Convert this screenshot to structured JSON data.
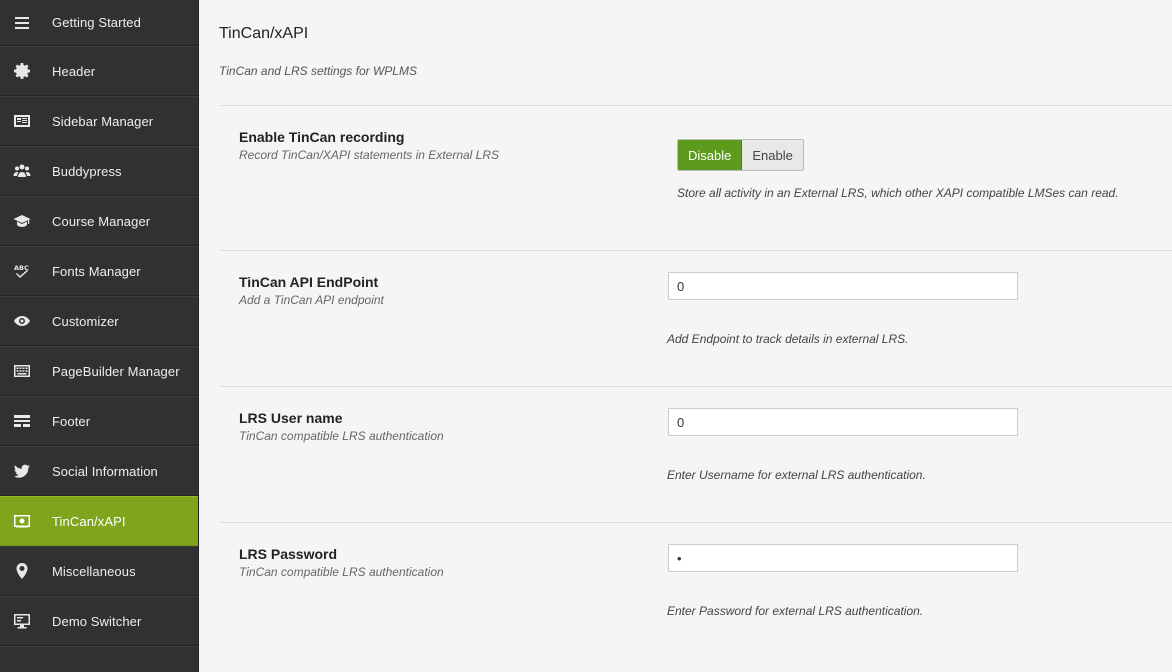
{
  "sidebar": {
    "items": [
      {
        "label": "Getting Started",
        "icon": "menu-icon"
      },
      {
        "label": "Header",
        "icon": "gear-icon"
      },
      {
        "label": "Sidebar Manager",
        "icon": "sidebar-layout-icon"
      },
      {
        "label": "Buddypress",
        "icon": "users-group-icon"
      },
      {
        "label": "Course Manager",
        "icon": "graduation-cap-icon"
      },
      {
        "label": "Fonts Manager",
        "icon": "abc-check-icon"
      },
      {
        "label": "Customizer",
        "icon": "eye-icon"
      },
      {
        "label": "PageBuilder Manager",
        "icon": "keyboard-icon"
      },
      {
        "label": "Footer",
        "icon": "footer-layout-icon"
      },
      {
        "label": "Social Information",
        "icon": "twitter-bird-icon"
      },
      {
        "label": "TinCan/xAPI",
        "icon": "tincan-screen-icon",
        "active": true
      },
      {
        "label": "Miscellaneous",
        "icon": "map-pin-icon"
      },
      {
        "label": "Demo Switcher",
        "icon": "monitor-icon"
      }
    ],
    "active_color": "#7fa51d",
    "background": "#313131"
  },
  "main": {
    "title": "TinCan/xAPI",
    "description": "TinCan and LRS settings for WPLMS",
    "fields": {
      "enable": {
        "title": "Enable TinCan recording",
        "subtitle": "Record TinCan/XAPI statements in External LRS",
        "options": [
          "Disable",
          "Enable"
        ],
        "selected": "Disable",
        "hint": "Store all activity in an External LRS, which other XAPI compatible LMSes can read."
      },
      "endpoint": {
        "title": "TinCan API EndPoint",
        "subtitle": "Add a TinCan API endpoint",
        "value": "0",
        "hint": "Add Endpoint to track details in external LRS."
      },
      "username": {
        "title": "LRS User name",
        "subtitle": "TinCan compatible LRS authentication",
        "value": "0",
        "hint": "Enter Username for external LRS authentication."
      },
      "password": {
        "title": "LRS Password",
        "subtitle": "TinCan compatible LRS authentication",
        "value": "•",
        "hint": "Enter Password for external LRS authentication."
      }
    },
    "accent_button_color": "#5d9b1c"
  }
}
